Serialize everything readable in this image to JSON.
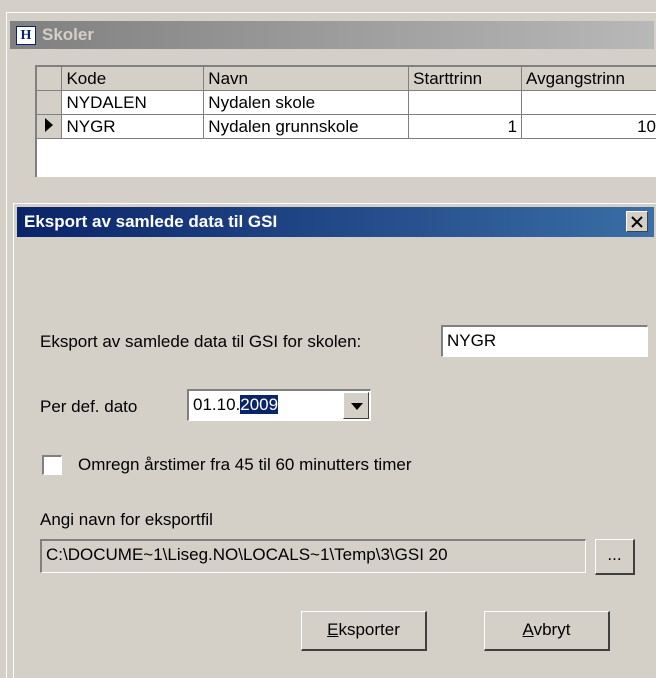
{
  "back_window": {
    "title": "Skoler",
    "title_icon": "H",
    "grid": {
      "columns": [
        "Kode",
        "Navn",
        "Starttrinn",
        "Avgangstrinn"
      ],
      "rows": [
        {
          "kode": "NYDALEN",
          "navn": "Nydalen skole",
          "start": "",
          "avgang": ""
        },
        {
          "kode": "NYGR",
          "navn": "Nydalen grunnskole",
          "start": "1",
          "avgang": "10"
        }
      ]
    }
  },
  "dialog": {
    "title": "Eksport av samlede data til GSI",
    "school_label": "Eksport av samlede data til GSI for skolen:",
    "school_value": "NYGR",
    "date_label": "Per def. dato",
    "date_prefix": "01.10.",
    "date_selected": "2009",
    "checkbox_label": "Omregn årstimer fra 45 til 60 minutters timer",
    "checkbox_checked": false,
    "file_label": "Angi navn for eksportfil",
    "file_value": "C:\\DOCUME~1\\Liseg.NO\\LOCALS~1\\Temp\\3\\GSI 20",
    "browse_label": "...",
    "export_button": {
      "mnemonic": "E",
      "rest": "ksporter"
    },
    "cancel_button": {
      "mnemonic": "A",
      "rest": "vbryt"
    }
  }
}
